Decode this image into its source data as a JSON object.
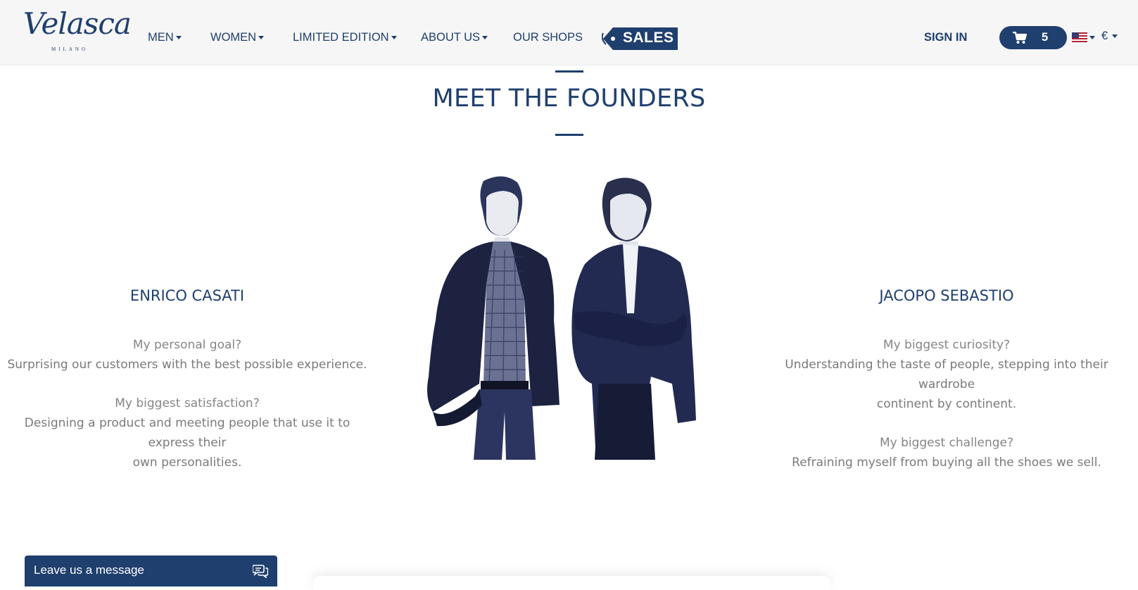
{
  "brand": {
    "logo_script": "Velasca",
    "logo_sub": "MILANO"
  },
  "nav": {
    "items": [
      {
        "label": "MEN",
        "dropdown": true
      },
      {
        "label": "WOMEN",
        "dropdown": true
      },
      {
        "label": "LIMITED EDITION",
        "dropdown": true
      },
      {
        "label": "ABOUT US",
        "dropdown": true
      },
      {
        "label": "OUR SHOPS",
        "dropdown": false
      }
    ],
    "sales_label": "SALES",
    "sign_in_label": "SIGN IN",
    "cart_count": "5",
    "cart_icon": "shopping-cart-icon",
    "flag_icon": "us-flag-icon",
    "currency": "€"
  },
  "main": {
    "title": "MEET THE FOUNDERS",
    "founders": [
      {
        "name": "ENRICO CASATI",
        "qa": [
          {
            "question": "My personal goal?",
            "answer_lines": [
              "Surprising our customers with the best possible experience."
            ]
          },
          {
            "question": "My biggest satisfaction?",
            "answer_lines": [
              "Designing a product and meeting people that use it to express their",
              "own personalities."
            ]
          }
        ]
      },
      {
        "name": "JACOPO SEBASTIO",
        "qa": [
          {
            "question": "My biggest curiosity?",
            "answer_lines": [
              "Understanding the taste of people, stepping into their wardrobe",
              "continent by continent."
            ]
          },
          {
            "question": "My biggest challenge?",
            "answer_lines": [
              "Refraining myself from buying all the shoes we sell."
            ]
          }
        ]
      }
    ]
  },
  "chat": {
    "label": "Leave us a message",
    "icon": "chat-bubbles-icon"
  },
  "colors": {
    "brand_navy": "#1f3f6e",
    "header_bg": "#f6f6f6",
    "body_text": "#7a7a7a"
  }
}
